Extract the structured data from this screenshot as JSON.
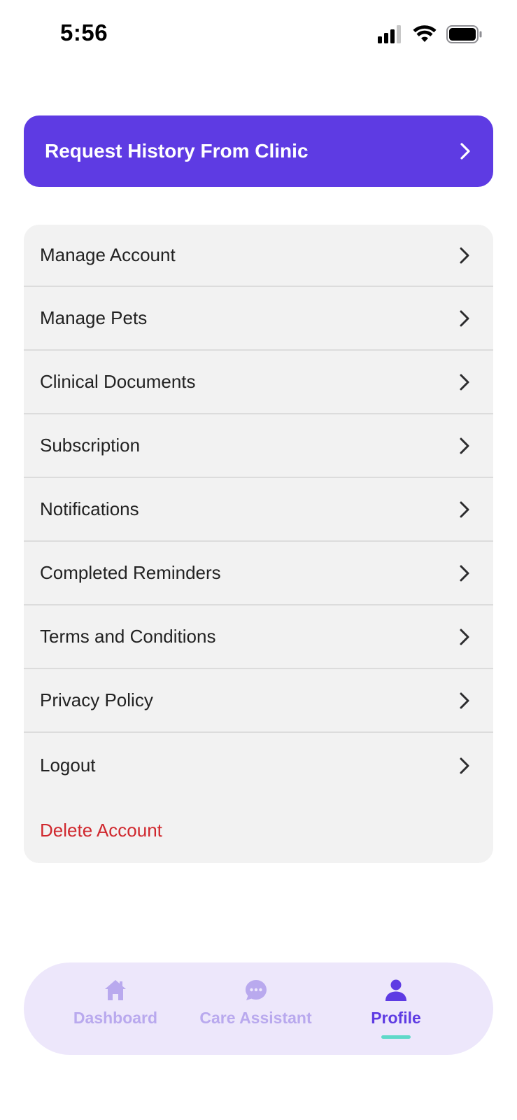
{
  "status_bar": {
    "time": "5:56"
  },
  "request_history": {
    "label": "Request History From Clinic"
  },
  "menu": {
    "items": [
      {
        "label": "Manage Account"
      },
      {
        "label": "Manage Pets"
      },
      {
        "label": "Clinical Documents"
      },
      {
        "label": "Subscription"
      },
      {
        "label": "Notifications"
      },
      {
        "label": "Completed Reminders"
      },
      {
        "label": "Terms and Conditions"
      },
      {
        "label": "Privacy Policy"
      },
      {
        "label": "Logout"
      }
    ],
    "delete_label": "Delete Account"
  },
  "tab_bar": {
    "tabs": [
      {
        "label": "Dashboard",
        "icon": "home-icon",
        "active": false
      },
      {
        "label": "Care Assistant",
        "icon": "chat-icon",
        "active": false
      },
      {
        "label": "Profile",
        "icon": "person-icon",
        "active": true
      }
    ]
  },
  "colors": {
    "accent": "#5e3be3",
    "danger": "#d0282e",
    "tab_bar_bg": "#ede7fb",
    "tab_inactive": "#b9a9ee",
    "tab_indicator": "#5fd9c9"
  }
}
